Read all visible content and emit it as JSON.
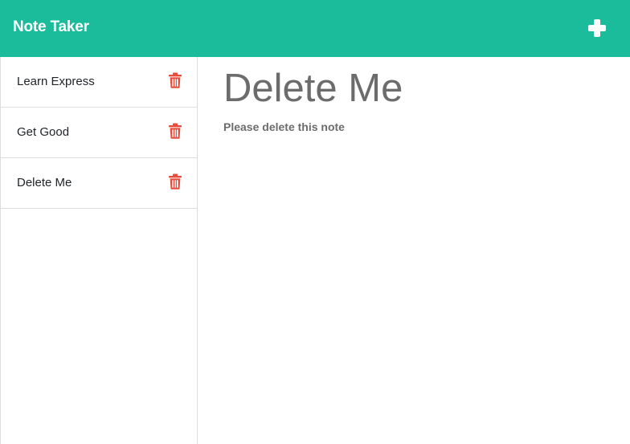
{
  "navbar": {
    "brand": "Note Taker",
    "new_note_icon": "plus-icon",
    "background_color": "#1abc9c"
  },
  "sidebar": {
    "notes": [
      {
        "title": "Learn Express",
        "delete_icon": "trash-icon"
      },
      {
        "title": "Get Good",
        "delete_icon": "trash-icon"
      },
      {
        "title": "Delete Me",
        "delete_icon": "trash-icon"
      }
    ],
    "delete_icon_color": "#e74c3c"
  },
  "active_note": {
    "title": "Delete Me",
    "text": "Please delete this note"
  }
}
